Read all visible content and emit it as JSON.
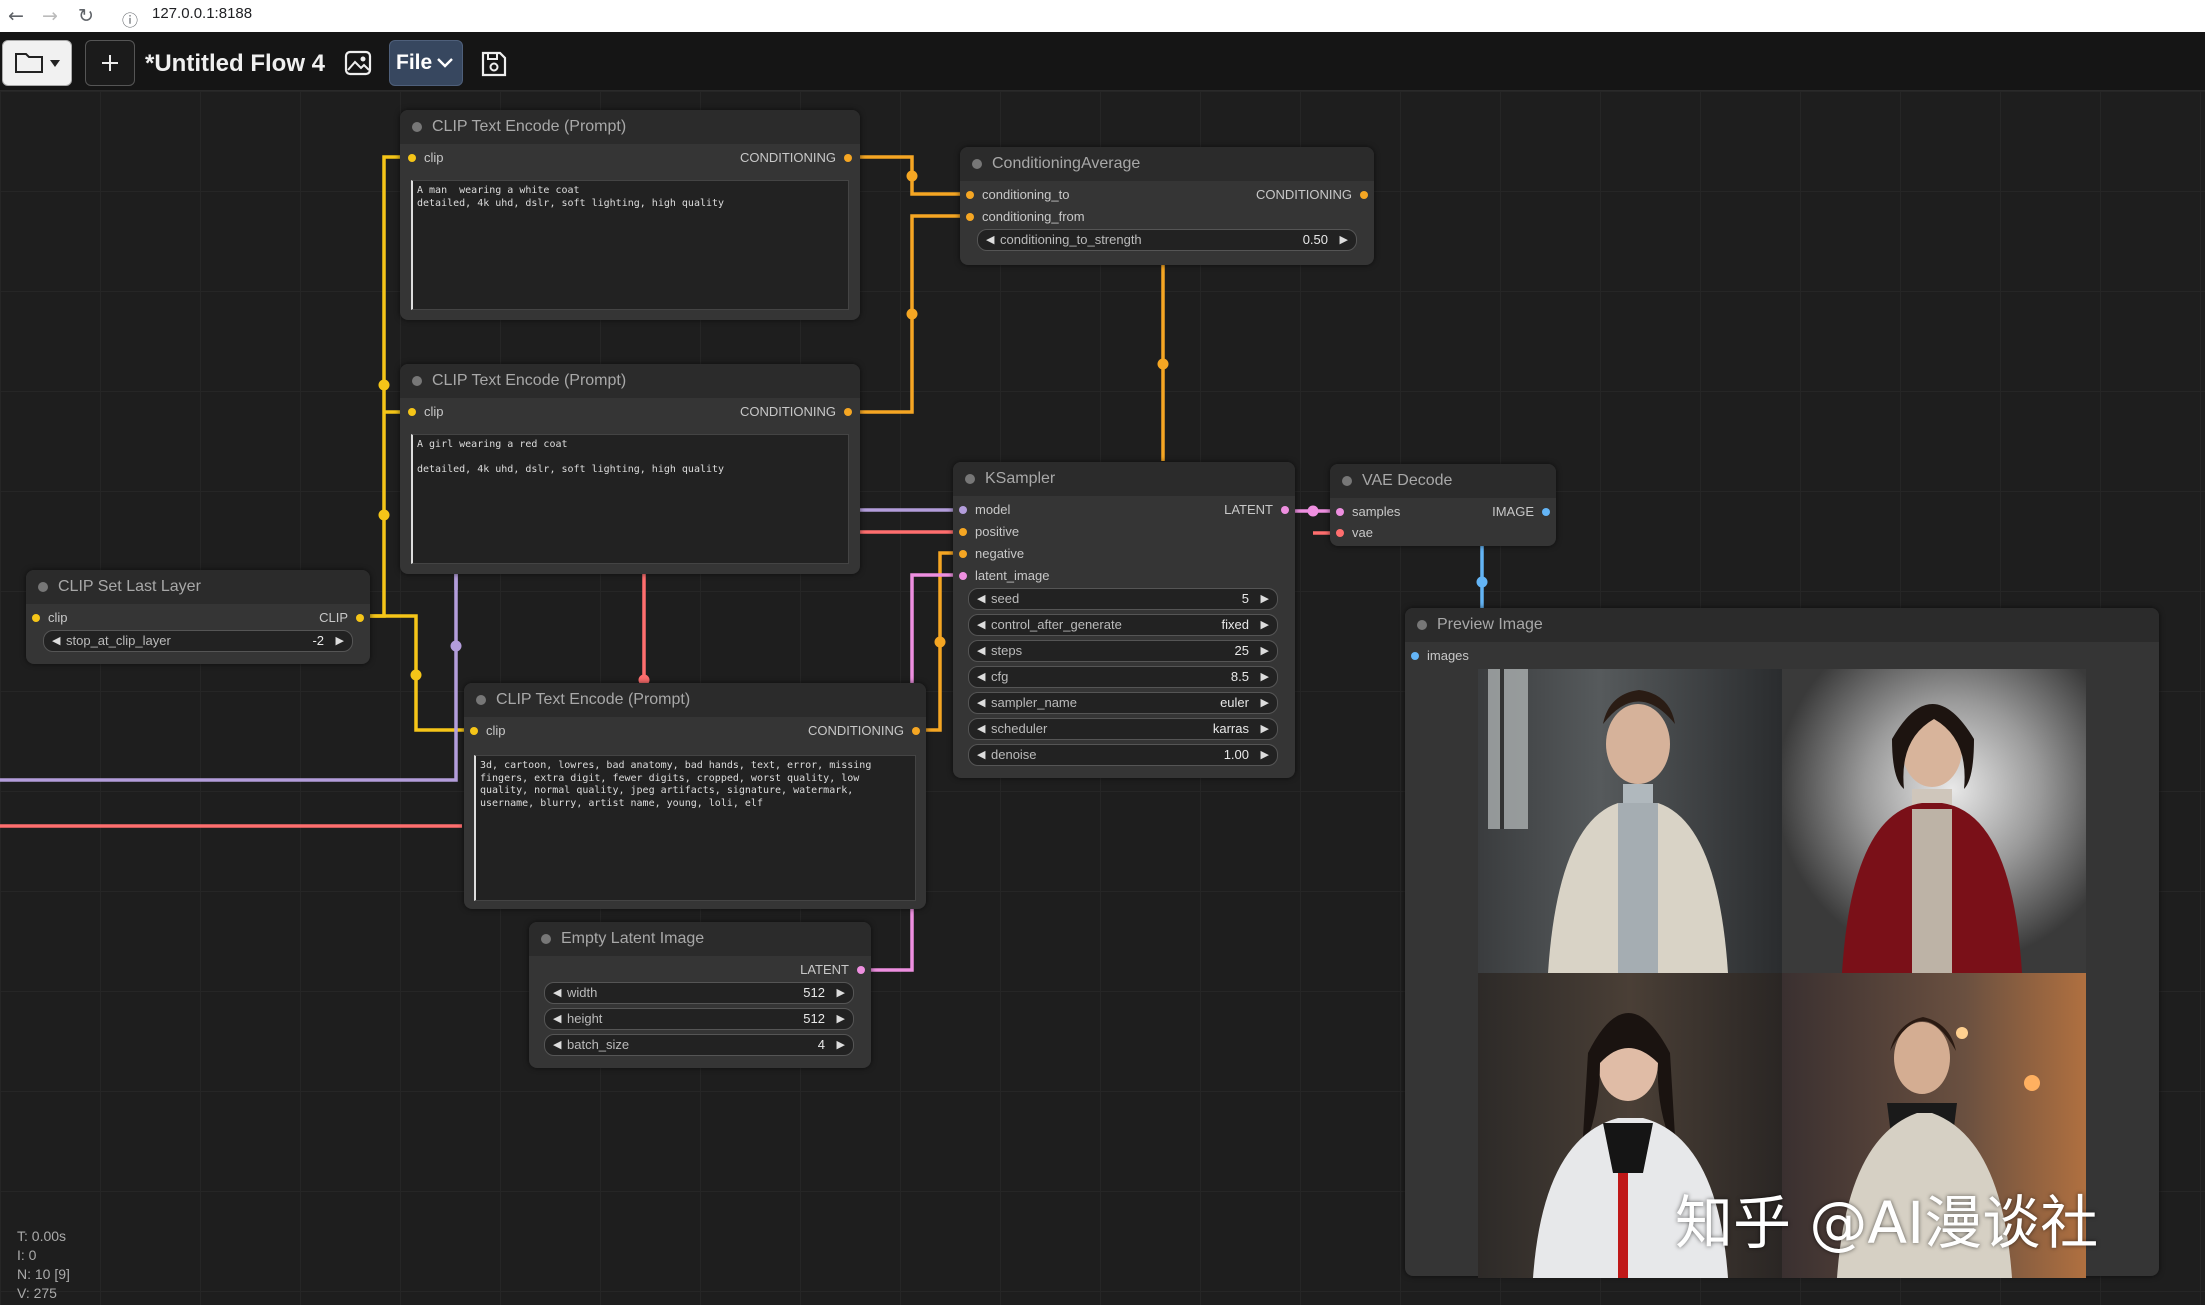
{
  "browser": {
    "url": "127.0.0.1:8188"
  },
  "toolbar": {
    "title": "*Untitled Flow 4",
    "file_label": "File"
  },
  "nodes": {
    "clip_text_1": {
      "title": "CLIP Text Encode (Prompt)",
      "input": "clip",
      "output": "CONDITIONING",
      "text": "A man  wearing a white coat\ndetailed, 4k uhd, dslr, soft lighting, high quality"
    },
    "clip_text_2": {
      "title": "CLIP Text Encode (Prompt)",
      "input": "clip",
      "output": "CONDITIONING",
      "text": "A girl wearing a red coat\n\ndetailed, 4k uhd, dslr, soft lighting, high quality"
    },
    "clip_text_3": {
      "title": "CLIP Text Encode (Prompt)",
      "input": "clip",
      "output": "CONDITIONING",
      "text": "3d, cartoon, lowres, bad anatomy, bad hands, text, error, missing fingers, extra digit, fewer digits, cropped, worst quality, low quality, normal quality, jpeg artifacts, signature, watermark, username, blurry, artist name, young, loli, elf"
    },
    "conditioning_average": {
      "title": "ConditioningAverage",
      "inputs": [
        "conditioning_to",
        "conditioning_from"
      ],
      "output": "CONDITIONING",
      "widget_label": "conditioning_to_strength",
      "widget_value": "0.50"
    },
    "clip_set_last_layer": {
      "title": "CLIP Set Last Layer",
      "input": "clip",
      "output": "CLIP",
      "widget_label": "stop_at_clip_layer",
      "widget_value": "-2"
    },
    "ksampler": {
      "title": "KSampler",
      "inputs": [
        "model",
        "positive",
        "negative",
        "latent_image"
      ],
      "output": "LATENT",
      "widgets": [
        {
          "label": "seed",
          "value": "5"
        },
        {
          "label": "control_after_generate",
          "value": "fixed"
        },
        {
          "label": "steps",
          "value": "25"
        },
        {
          "label": "cfg",
          "value": "8.5"
        },
        {
          "label": "sampler_name",
          "value": "euler"
        },
        {
          "label": "scheduler",
          "value": "karras"
        },
        {
          "label": "denoise",
          "value": "1.00"
        }
      ]
    },
    "vae_decode": {
      "title": "VAE Decode",
      "inputs": [
        "samples",
        "vae"
      ],
      "output": "IMAGE"
    },
    "preview_image": {
      "title": "Preview Image",
      "input": "images"
    },
    "empty_latent": {
      "title": "Empty Latent Image",
      "output": "LATENT",
      "widgets": [
        {
          "label": "width",
          "value": "512"
        },
        {
          "label": "height",
          "value": "512"
        },
        {
          "label": "batch_size",
          "value": "4"
        }
      ]
    }
  },
  "watermark": "知乎 @AI漫谈社",
  "stats": {
    "t": "T: 0.00s",
    "i": "I: 0",
    "n": "N: 10 [9]",
    "v": "V: 275"
  },
  "colors": {
    "clip": "#f5c518",
    "conditioning": "#f5a623",
    "model": "#b39ddb",
    "latent": "#ee8fe0",
    "vae": "#ff6e6e",
    "image": "#64b5f6"
  }
}
